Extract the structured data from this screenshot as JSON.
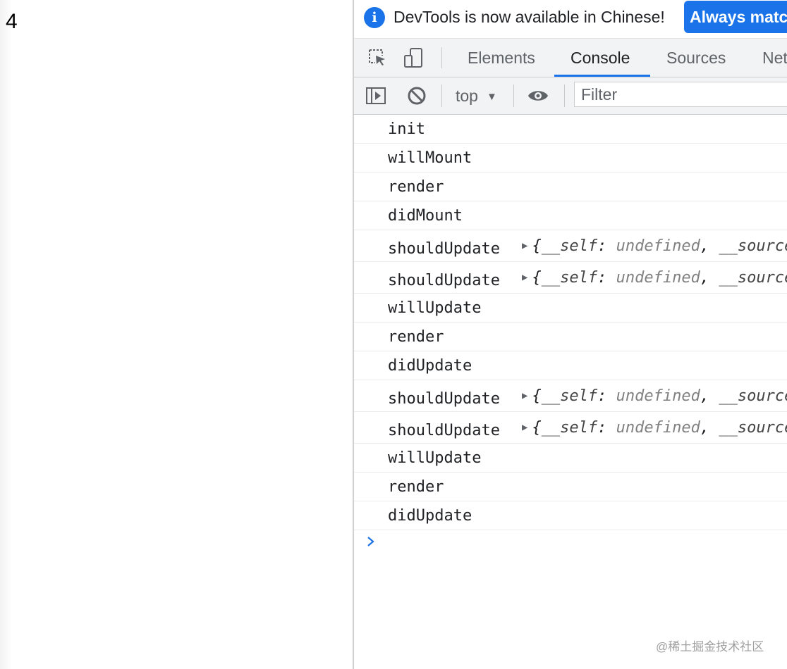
{
  "page": {
    "counter_value": "4"
  },
  "banner": {
    "icon": "info-icon",
    "message": "DevTools is now available in Chinese!",
    "button_label": "Always match"
  },
  "tabbar": {
    "inspect_icon": "inspect-element-icon",
    "device_icon": "device-toolbar-icon",
    "tabs": [
      {
        "label": "Elements",
        "active": false
      },
      {
        "label": "Console",
        "active": true
      },
      {
        "label": "Sources",
        "active": false
      },
      {
        "label": "Network",
        "active": false
      }
    ]
  },
  "console_toolbar": {
    "sidebar_icon": "show-sidebar-icon",
    "clear_icon": "clear-console-icon",
    "context": "top",
    "eye_icon": "live-expression-icon",
    "filter_placeholder": "Filter"
  },
  "messages": [
    {
      "text": "init"
    },
    {
      "text": "willMount"
    },
    {
      "text": "render"
    },
    {
      "text": "didMount"
    },
    {
      "text": "shouldUpdate",
      "object": {
        "key1": "__self",
        "val1": "undefined",
        "key2": "__source"
      }
    },
    {
      "text": "shouldUpdate",
      "object": {
        "key1": "__self",
        "val1": "undefined",
        "key2": "__source"
      }
    },
    {
      "text": "willUpdate"
    },
    {
      "text": "render"
    },
    {
      "text": "didUpdate"
    },
    {
      "text": "shouldUpdate",
      "object": {
        "key1": "__self",
        "val1": "undefined",
        "key2": "__source"
      }
    },
    {
      "text": "shouldUpdate",
      "object": {
        "key1": "__self",
        "val1": "undefined",
        "key2": "__source"
      }
    },
    {
      "text": "willUpdate"
    },
    {
      "text": "render"
    },
    {
      "text": "didUpdate"
    }
  ],
  "prompt_icon": "chevron-right-icon",
  "watermark": "@稀土掘金技术社区",
  "colors": {
    "accent": "#1a73e8",
    "toolbar_bg": "#f1f3f4",
    "text": "#202124"
  }
}
